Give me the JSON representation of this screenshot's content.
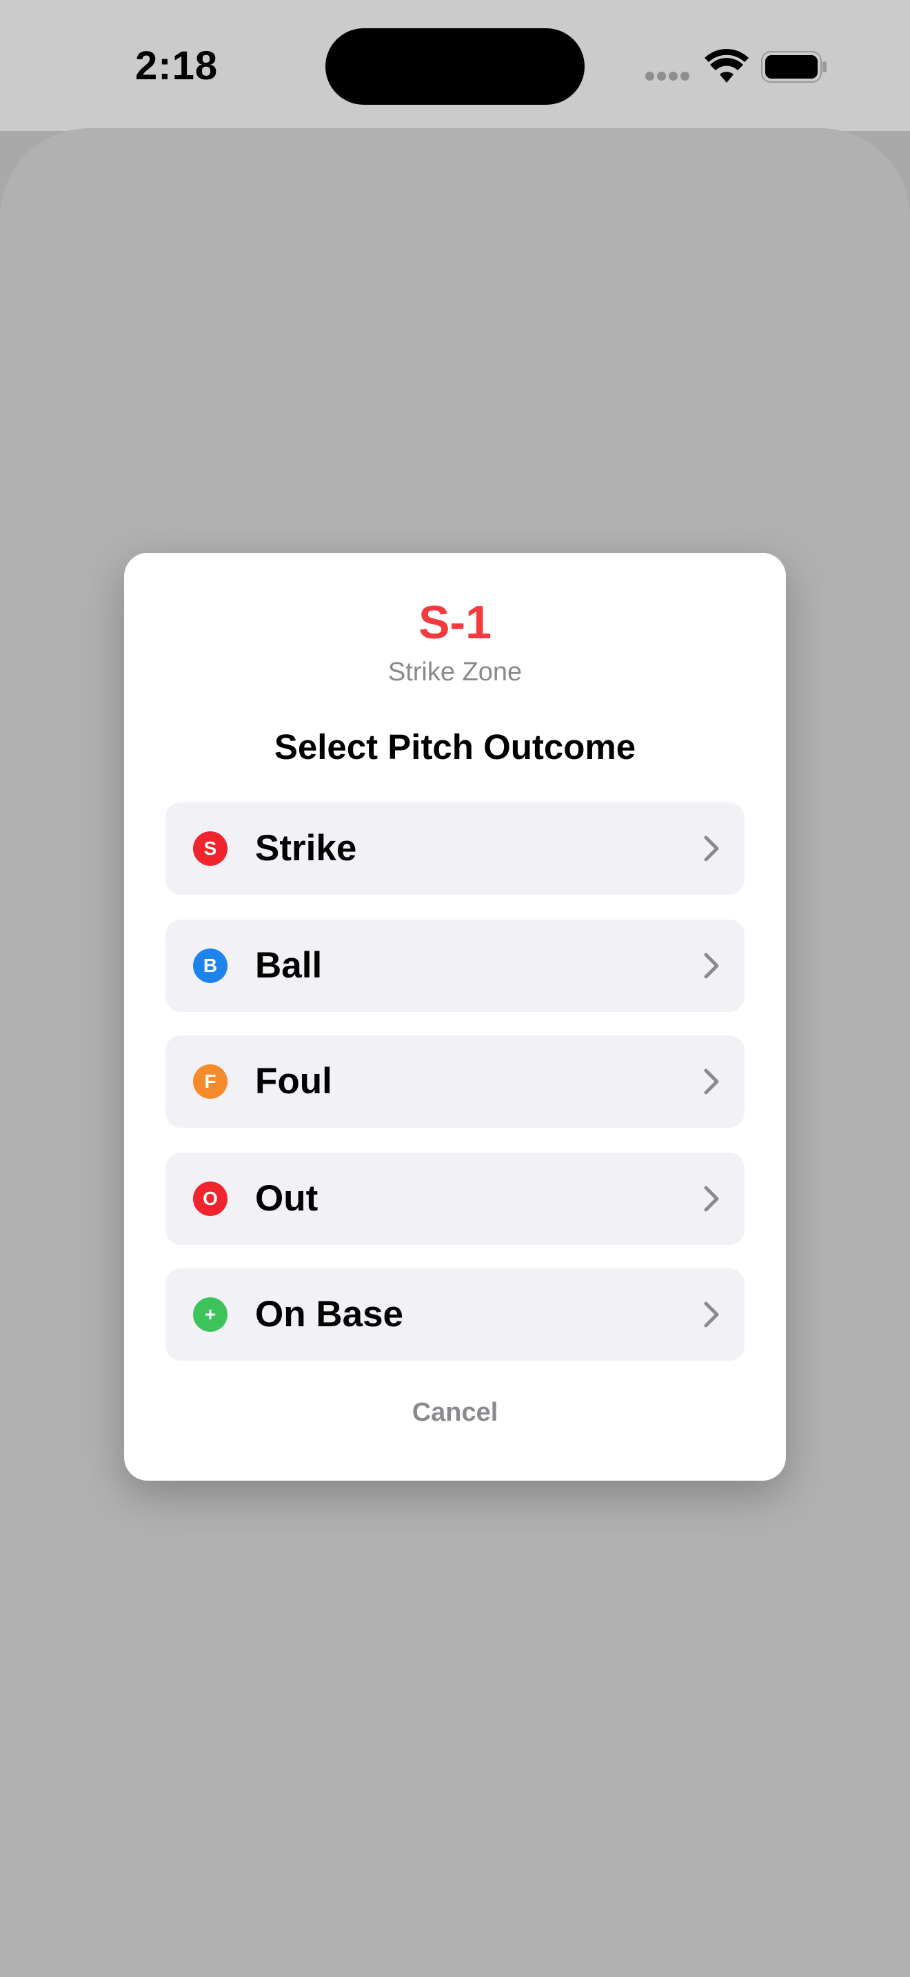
{
  "status_bar": {
    "time": "2:18"
  },
  "dialog": {
    "zone_code": "S-1",
    "zone_name": "Strike Zone",
    "prompt": "Select Pitch Outcome",
    "options": [
      {
        "badge": "S",
        "label": "Strike",
        "color": "#f0242d"
      },
      {
        "badge": "B",
        "label": "Ball",
        "color": "#1e84ec"
      },
      {
        "badge": "F",
        "label": "Foul",
        "color": "#f58a2b"
      },
      {
        "badge": "O",
        "label": "Out",
        "color": "#f0242d"
      },
      {
        "badge": "+",
        "label": "On Base",
        "color": "#3cc35a"
      }
    ],
    "cancel_label": "Cancel"
  },
  "icons": {
    "option_arrow": "chevron-right-icon",
    "wifi": "wifi-icon",
    "battery": "battery-icon",
    "cellular": "cellular-signal-icon"
  }
}
